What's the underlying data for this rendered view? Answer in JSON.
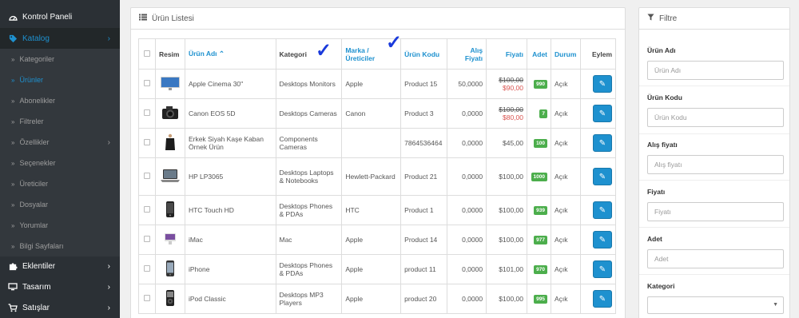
{
  "sidebar": {
    "items": [
      {
        "label": "Kontrol Paneli",
        "icon": "dashboard-icon"
      },
      {
        "label": "Katalog",
        "icon": "tag-icon"
      },
      {
        "label": "Eklentiler",
        "icon": "puzzle-icon"
      },
      {
        "label": "Tasarım",
        "icon": "monitor-icon"
      },
      {
        "label": "Satışlar",
        "icon": "cart-icon"
      }
    ],
    "subitems": [
      "Kategoriler",
      "Ürünler",
      "Abonelikler",
      "Filtreler",
      "Özellikler",
      "Seçenekler",
      "Üreticiler",
      "Dosyalar",
      "Yorumlar",
      "Bilgi Sayfaları"
    ]
  },
  "product_list": {
    "title": "Ürün Listesi",
    "columns": {
      "image": "Resim",
      "name": "Ürün Adı",
      "category": "Kategori",
      "brand": "Marka / Üreticiler",
      "code": "Ürün Kodu",
      "purchase_price": "Alış Fiyatı",
      "price": "Fiyatı",
      "quantity": "Adet",
      "status": "Durum",
      "action": "Eylem"
    },
    "rows": [
      {
        "name": "Apple Cinema 30\"",
        "category": "Desktops Monitors",
        "brand": "Apple",
        "code": "Product 15",
        "purchase": "50,0000",
        "old_price": "$100,00",
        "price": "$90,00",
        "qty": "990",
        "status": "Açık"
      },
      {
        "name": "Canon EOS 5D",
        "category": "Desktops Cameras",
        "brand": "Canon",
        "code": "Product 3",
        "purchase": "0,0000",
        "old_price": "$100,00",
        "price": "$80,00",
        "qty": "7",
        "status": "Açık"
      },
      {
        "name": "Erkek Siyah Kaşe Kaban Örnek Ürün",
        "category": "Components Cameras",
        "brand": "",
        "code": "7864536464",
        "purchase": "0,0000",
        "old_price": "",
        "price": "$45,00",
        "qty": "100",
        "status": "Açık"
      },
      {
        "name": "HP LP3065",
        "category": "Desktops Laptops & Notebooks",
        "brand": "Hewlett-Packard",
        "code": "Product 21",
        "purchase": "0,0000",
        "old_price": "",
        "price": "$100,00",
        "qty": "1000",
        "status": "Açık"
      },
      {
        "name": "HTC Touch HD",
        "category": "Desktops Phones & PDAs",
        "brand": "HTC",
        "code": "Product 1",
        "purchase": "0,0000",
        "old_price": "",
        "price": "$100,00",
        "qty": "939",
        "status": "Açık"
      },
      {
        "name": "iMac",
        "category": "Mac",
        "brand": "Apple",
        "code": "Product 14",
        "purchase": "0,0000",
        "old_price": "",
        "price": "$100,00",
        "qty": "977",
        "status": "Açık"
      },
      {
        "name": "iPhone",
        "category": "Desktops Phones & PDAs",
        "brand": "Apple",
        "code": "product 11",
        "purchase": "0,0000",
        "old_price": "",
        "price": "$101,00",
        "qty": "970",
        "status": "Açık"
      },
      {
        "name": "iPod Classic",
        "category": "Desktops MP3 Players",
        "brand": "Apple",
        "code": "product 20",
        "purchase": "0,0000",
        "old_price": "",
        "price": "$100,00",
        "qty": "995",
        "status": "Açık"
      }
    ]
  },
  "filter": {
    "title": "Filtre",
    "name_label": "Ürün Adı",
    "name_placeholder": "Ürün Adı",
    "code_label": "Ürün Kodu",
    "code_placeholder": "Ürün Kodu",
    "purchase_label": "Alış fiyatı",
    "purchase_placeholder": "Alış fiyatı",
    "price_label": "Fiyatı",
    "price_placeholder": "Fiyatı",
    "qty_label": "Adet",
    "qty_placeholder": "Adet",
    "category_label": "Kategori",
    "category_value": ""
  },
  "colors": {
    "accent": "#1e91cf",
    "sidebar_bg": "#2b3035",
    "badge_green": "#4cae4c",
    "discount_red": "#d9534f",
    "annotation_check": "#1a3adb"
  }
}
